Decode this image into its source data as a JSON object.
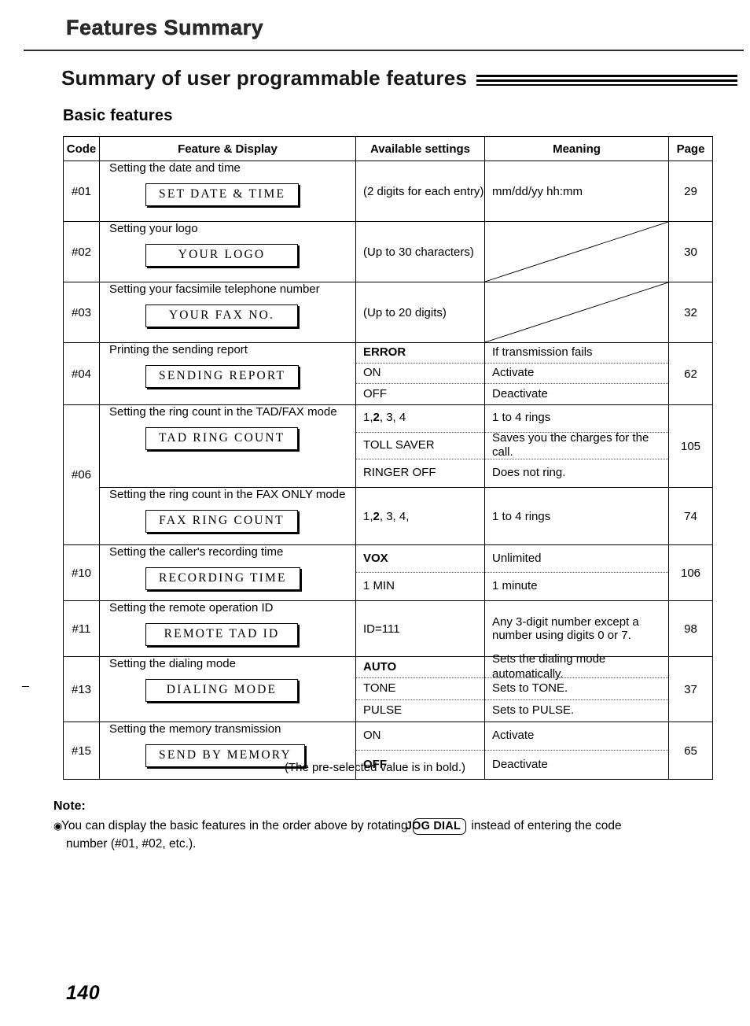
{
  "running_head": "Features Summary",
  "section_title": "Summary of user programmable features",
  "subsection_title": "Basic features",
  "table": {
    "headers": {
      "code": "Code",
      "feature": "Feature & Display",
      "settings": "Available settings",
      "meaning": "Meaning",
      "page": "Page"
    },
    "rows": [
      {
        "code": "#01",
        "description": "Setting the date and time",
        "display": "SET DATE & TIME",
        "settings": [
          "(2 digits for each entry)"
        ],
        "meanings": [
          "mm/dd/yy  hh:mm"
        ],
        "page": "29",
        "slash": false
      },
      {
        "code": "#02",
        "description": "Setting your logo",
        "display": "YOUR LOGO",
        "settings": [
          "(Up to 30 characters)"
        ],
        "meanings": [
          ""
        ],
        "page": "30",
        "slash": true
      },
      {
        "code": "#03",
        "description": "Setting your facsimile telephone number",
        "display": "YOUR FAX NO.",
        "settings": [
          "(Up to 20 digits)"
        ],
        "meanings": [
          ""
        ],
        "page": "32",
        "slash": true
      },
      {
        "code": "#04",
        "description": "Printing the sending report",
        "display": "SENDING REPORT",
        "settings": [
          "ERROR",
          "ON",
          "OFF"
        ],
        "settings_bold": [
          true,
          false,
          false
        ],
        "meanings": [
          "If transmission fails",
          "Activate",
          "Deactivate"
        ],
        "page": "62",
        "slash": false
      },
      {
        "code": "#06",
        "description": "Setting the ring count in the TAD/FAX mode",
        "display": "TAD RING COUNT",
        "settings": [
          "1, 2, 3, 4",
          "TOLL SAVER",
          "RINGER OFF"
        ],
        "settings_bold": [
          false,
          false,
          false
        ],
        "settings_bold_index": [
          1
        ],
        "meanings": [
          "1 to 4 rings",
          "Saves you the charges for the call.",
          "Does not ring."
        ],
        "page": "105",
        "slash": false
      },
      {
        "code": "",
        "description": "Setting the ring count in the FAX ONLY mode",
        "display": "FAX RING COUNT",
        "settings": [
          "1, 2, 3, 4,"
        ],
        "settings_bold": [
          false
        ],
        "meanings": [
          "1 to 4 rings"
        ],
        "page": "74",
        "slash": false
      },
      {
        "code": "#10",
        "description": "Setting the caller's recording time",
        "display": "RECORDING TIME",
        "settings": [
          "VOX",
          "1 MIN"
        ],
        "settings_bold": [
          true,
          false
        ],
        "meanings": [
          "Unlimited",
          "1 minute"
        ],
        "page": "106",
        "slash": false
      },
      {
        "code": "#11",
        "description": "Setting the remote operation ID",
        "display": "REMOTE TAD ID",
        "settings": [
          "ID=111"
        ],
        "settings_bold": [
          false
        ],
        "meanings": [
          "Any 3-digit number except a number using digits 0 or 7."
        ],
        "page": "98",
        "slash": false
      },
      {
        "code": "#13",
        "description": "Setting the dialing mode",
        "display": "DIALING MODE",
        "settings": [
          "AUTO",
          "TONE",
          "PULSE"
        ],
        "settings_bold": [
          true,
          false,
          false
        ],
        "meanings": [
          "Sets the dialing mode automatically.",
          "Sets to TONE.",
          "Sets to PULSE."
        ],
        "page": "37",
        "slash": false
      },
      {
        "code": "#15",
        "description": "Setting the memory transmission",
        "display": "SEND BY MEMORY",
        "settings": [
          "ON",
          "OFF"
        ],
        "settings_bold": [
          false,
          true
        ],
        "meanings": [
          "Activate",
          "Deactivate"
        ],
        "page": "65",
        "slash": false
      }
    ]
  },
  "bold_note": "(The pre-selected value is in bold.)",
  "note": {
    "label": "Note:",
    "bullet": "◉",
    "text_before": "You can display the basic features in the order above by rotating",
    "key": "JOG DIAL",
    "text_after": "instead of entering the code",
    "text_continued": "number (#01, #02, etc.)."
  },
  "page_number": "140"
}
